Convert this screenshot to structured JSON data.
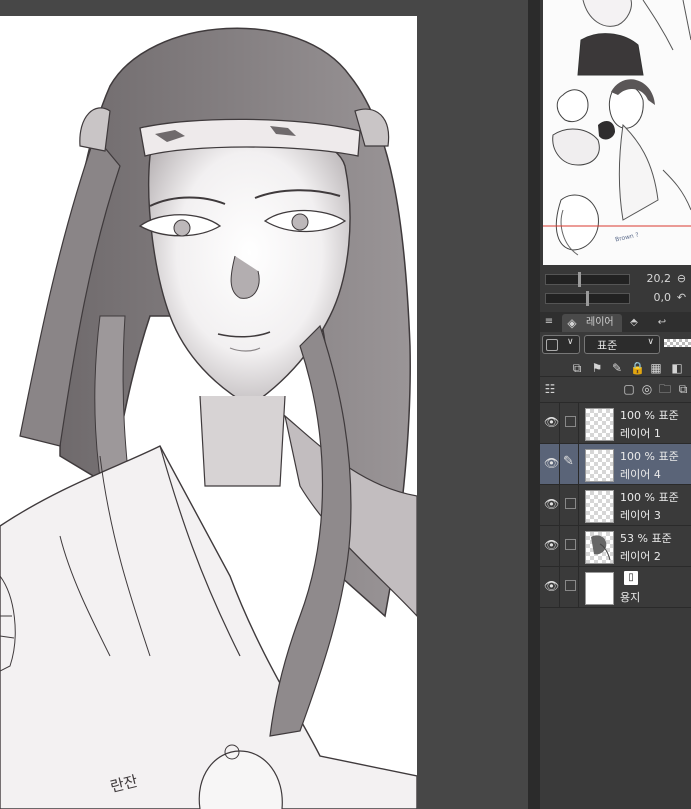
{
  "navigator": {
    "zoom_value": "20,2",
    "rotation_value": "0,0",
    "zoom_out_icon": "zoom-out-icon",
    "reset_rotation_icon": "rotate-reset-icon",
    "sketch_text": "Brown ?"
  },
  "layer_panel": {
    "tab_label": "레이어",
    "blend_mode": "표준",
    "layers": [
      {
        "opacity": "100 %",
        "mode": "표준",
        "name": "레이어 1",
        "selected": false,
        "visible": true
      },
      {
        "opacity": "100 %",
        "mode": "표준",
        "name": "레이어 4",
        "selected": true,
        "visible": true
      },
      {
        "opacity": "100 %",
        "mode": "표준",
        "name": "레이어 3",
        "selected": false,
        "visible": true
      },
      {
        "opacity": "53 %",
        "mode": "표준",
        "name": "레이어 2",
        "selected": false,
        "visible": true
      },
      {
        "opacity": "",
        "mode": "",
        "name": "용지",
        "selected": false,
        "visible": true
      }
    ],
    "selected_color": "#5a6478"
  },
  "canvas": {
    "sketch_label": "란잔"
  }
}
